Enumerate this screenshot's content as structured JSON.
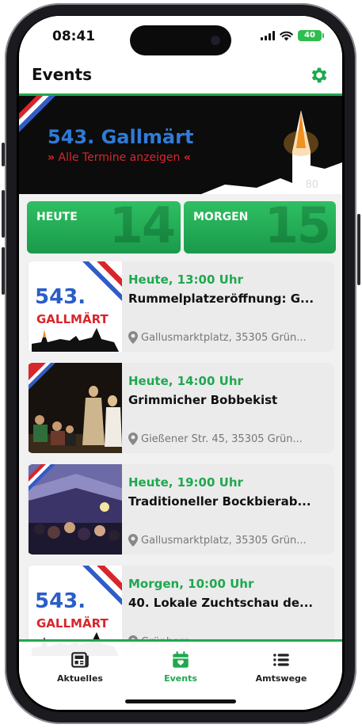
{
  "status": {
    "time": "08:41",
    "battery": "40"
  },
  "appbar": {
    "title": "Events"
  },
  "banner": {
    "title": "543. Gallmärt",
    "link": "Alle Termine anzeigen",
    "corner_num": "80"
  },
  "days": [
    {
      "label": "HEUTE",
      "day": "14"
    },
    {
      "label": "MORGEN",
      "day": "15"
    }
  ],
  "events": [
    {
      "time": "Heute, 13:00 Uhr",
      "title": "Rummelplatzeröffnung: G...",
      "location": "Gallusmarktplatz, 35305 Grün...",
      "thumb": "gallmaert-logo"
    },
    {
      "time": "Heute, 14:00 Uhr",
      "title": "Grimmicher Bobbekist",
      "location": "Gießener Str. 45, 35305 Grün...",
      "thumb": "theater-photo"
    },
    {
      "time": "Heute, 19:00 Uhr",
      "title": "Traditioneller Bockbierab...",
      "location": "Gallusmarktplatz, 35305 Grün...",
      "thumb": "tent-photo"
    },
    {
      "time": "Morgen, 10:00 Uhr",
      "title": "40. Lokale Zuchtschau de...",
      "location": "Grünberg",
      "thumb": "gallmaert-logo"
    }
  ],
  "logo": {
    "line1": "543.",
    "line2": "GALLMÄRT"
  },
  "nav": [
    {
      "label": "Aktuelles",
      "icon": "newspaper-icon"
    },
    {
      "label": "Events",
      "icon": "calendar-heart-icon"
    },
    {
      "label": "Amtswege",
      "icon": "list-icon"
    }
  ],
  "colors": {
    "accent": "#1fa84f",
    "banner_blue": "#2f7bd8",
    "banner_red": "#d8262b"
  }
}
